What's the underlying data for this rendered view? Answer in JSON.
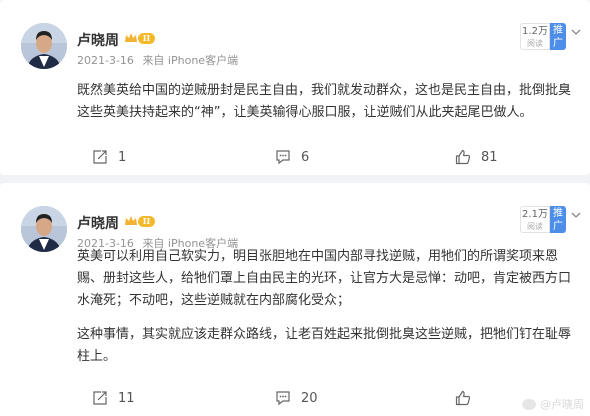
{
  "colors": {
    "background": "#f1f2f5",
    "card": "#ffffff",
    "promote_button": "#4d8fe8",
    "level_badge": "#f4b92a",
    "meta_text": "#939393"
  },
  "posts": [
    {
      "author": "卢晓周",
      "level_badge": "II",
      "date": "2021-3-16",
      "source": "来自 iPhone客户端",
      "reads_count": "1.2万",
      "reads_label": "阅读",
      "promote_label": "推广",
      "paragraphs": [
        "既然美英给中国的逆贼册封是民主自由，我们就发动群众，这也是民主自由，批倒批臭这些英美扶持起来的“神”，让美英输得心服口服，让逆贼们从此夹起尾巴做人。"
      ],
      "reposts": "1",
      "comments": "6",
      "likes": "81"
    },
    {
      "author": "卢晓周",
      "level_badge": "II",
      "date": "2021-3-16",
      "source": "来自 iPhone客户端",
      "reads_count": "2.1万",
      "reads_label": "阅读",
      "promote_label": "推广",
      "paragraphs": [
        "英美可以利用自己软实力，明目张胆地在中国内部寻找逆贼，用牠们的所谓奖项来恩赐、册封这些人，给牠们罩上自由民主的光环，让官方大是忌惮：动吧，肯定被西方口水淹死；不动吧，这些逆贼就在内部腐化受众；",
        "这种事情，其实就应该走群众路线，让老百姓起来批倒批臭这些逆贼，把牠们钉在耻辱柱上。"
      ],
      "reposts": "11",
      "comments": "20",
      "likes": ""
    }
  ],
  "icons": [
    "repost-icon",
    "comment-icon",
    "like-icon",
    "chevron-down-icon",
    "crown-icon"
  ],
  "watermark": "@卢晓周"
}
